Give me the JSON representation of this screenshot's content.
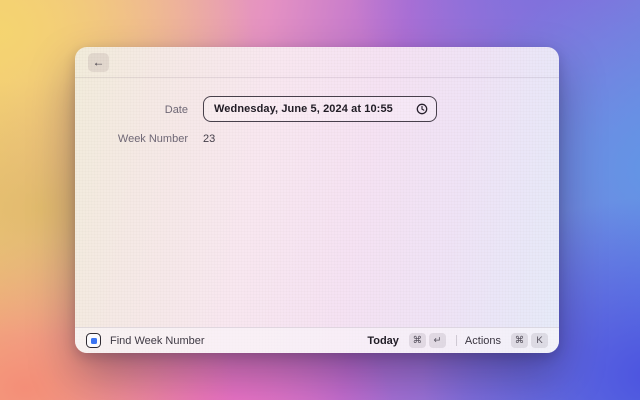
{
  "window": {
    "header": {
      "back_icon": "←"
    },
    "form": {
      "date_label": "Date",
      "date_value": "Wednesday, June 5, 2024 at 10:55",
      "week_number_label": "Week Number",
      "week_number_value": "23"
    },
    "footer": {
      "command_name": "Find Week Number",
      "today_label": "Today",
      "today_keys": [
        "⌘",
        "↵"
      ],
      "actions_label": "Actions",
      "actions_keys": [
        "⌘",
        "K"
      ]
    }
  },
  "icons": {
    "back": "back-arrow-icon",
    "clock": "clock-icon",
    "extension": "week-number-extension-icon",
    "command_key": "command-key-icon",
    "return_key": "return-key-icon"
  },
  "colors": {
    "extension_accent": "#3a74f2",
    "field_border": "#28212e",
    "wallpaper_palette": [
      "#f5d570",
      "#f58c76",
      "#ee6cc6",
      "#b56ed2",
      "#7e70dd",
      "#6296e6",
      "#4a50e0"
    ]
  }
}
